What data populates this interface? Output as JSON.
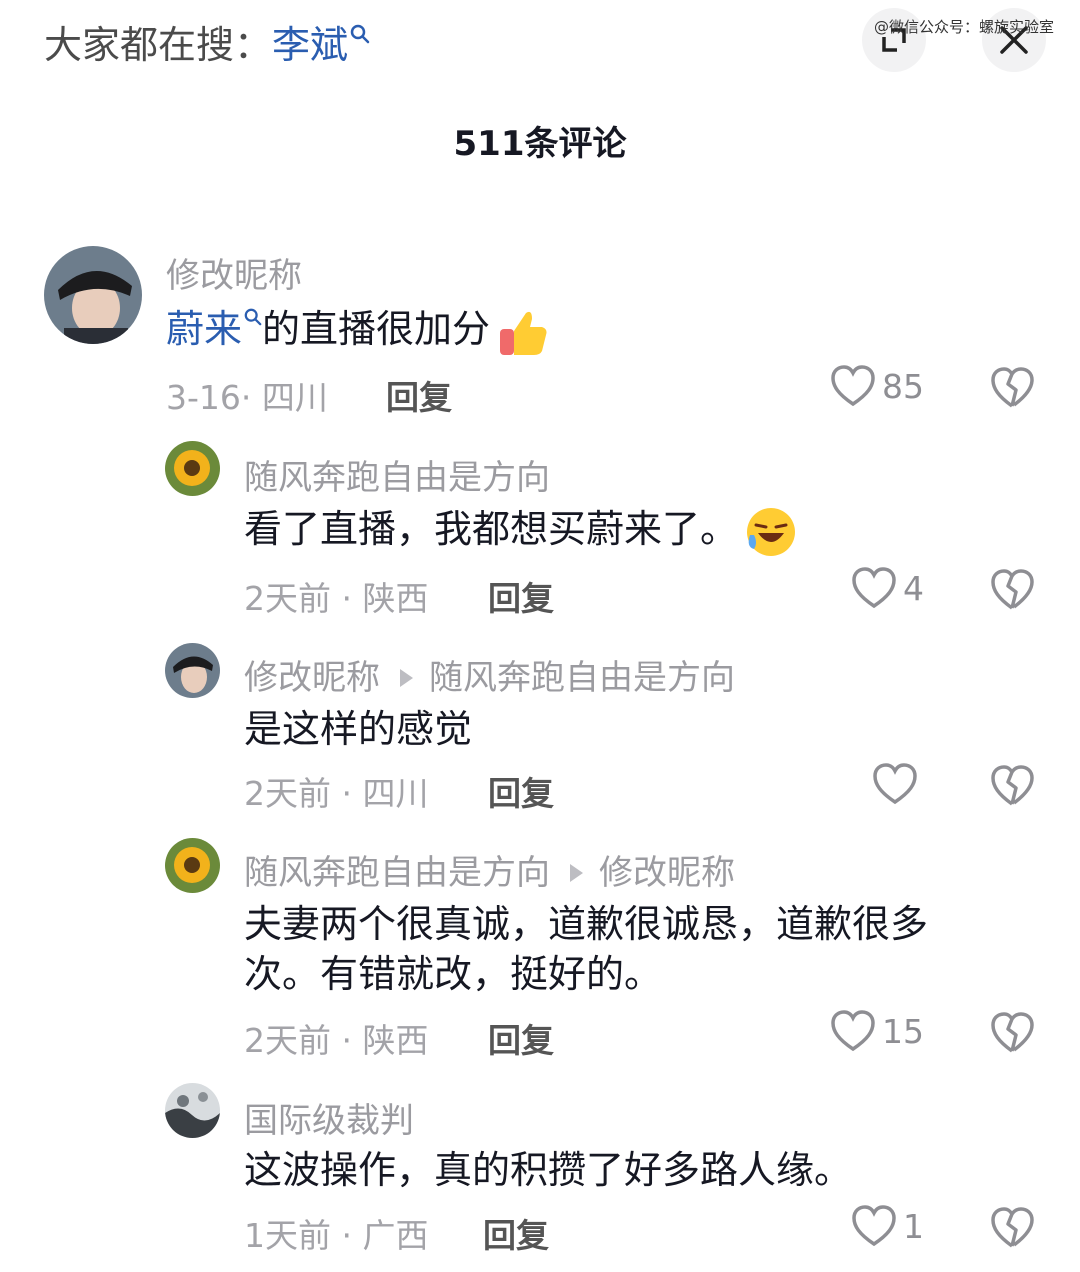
{
  "search": {
    "prefix": "大家都在搜：",
    "term": "李斌"
  },
  "watermark": "@微信公众号：螺旋实验室",
  "header": {
    "title": "511条评论"
  },
  "comments": [
    {
      "user": "修改昵称",
      "text_link": "蔚来",
      "text_rest": "的直播很加分",
      "emoji": "thumbs-up",
      "date": "3-16",
      "location": "四川",
      "reply_label": "回复",
      "likes": "85"
    },
    {
      "user": "随风奔跑自由是方向",
      "text": "看了直播，我都想买蔚来了。",
      "emoji": "laughing-crying",
      "date": "2天前",
      "location": "陕西",
      "reply_label": "回复",
      "likes": "4"
    },
    {
      "user": "修改昵称",
      "reply_to": "随风奔跑自由是方向",
      "text": "是这样的感觉",
      "date": "2天前",
      "location": "四川",
      "reply_label": "回复",
      "likes": ""
    },
    {
      "user": "随风奔跑自由是方向",
      "reply_to": "修改昵称",
      "text_line1": "夫妻两个很真诚，道歉很诚恳，道歉很多",
      "text_line2": "次。有错就改，挺好的。",
      "date": "2天前",
      "location": "陕西",
      "reply_label": "回复",
      "likes": "15"
    },
    {
      "user": "国际级裁判",
      "text": "这波操作，真的积攒了好多路人缘。",
      "date": "1天前",
      "location": "广西",
      "reply_label": "回复",
      "likes": "1"
    }
  ],
  "icons": {
    "search": "magnifier-icon",
    "expand": "expand-icon",
    "close": "close-icon",
    "like": "heart-outline-icon",
    "dislike": "broken-heart-icon"
  },
  "colors": {
    "link": "#2a5db0",
    "meta": "#a3a3a8",
    "username": "#9b9ba0"
  }
}
